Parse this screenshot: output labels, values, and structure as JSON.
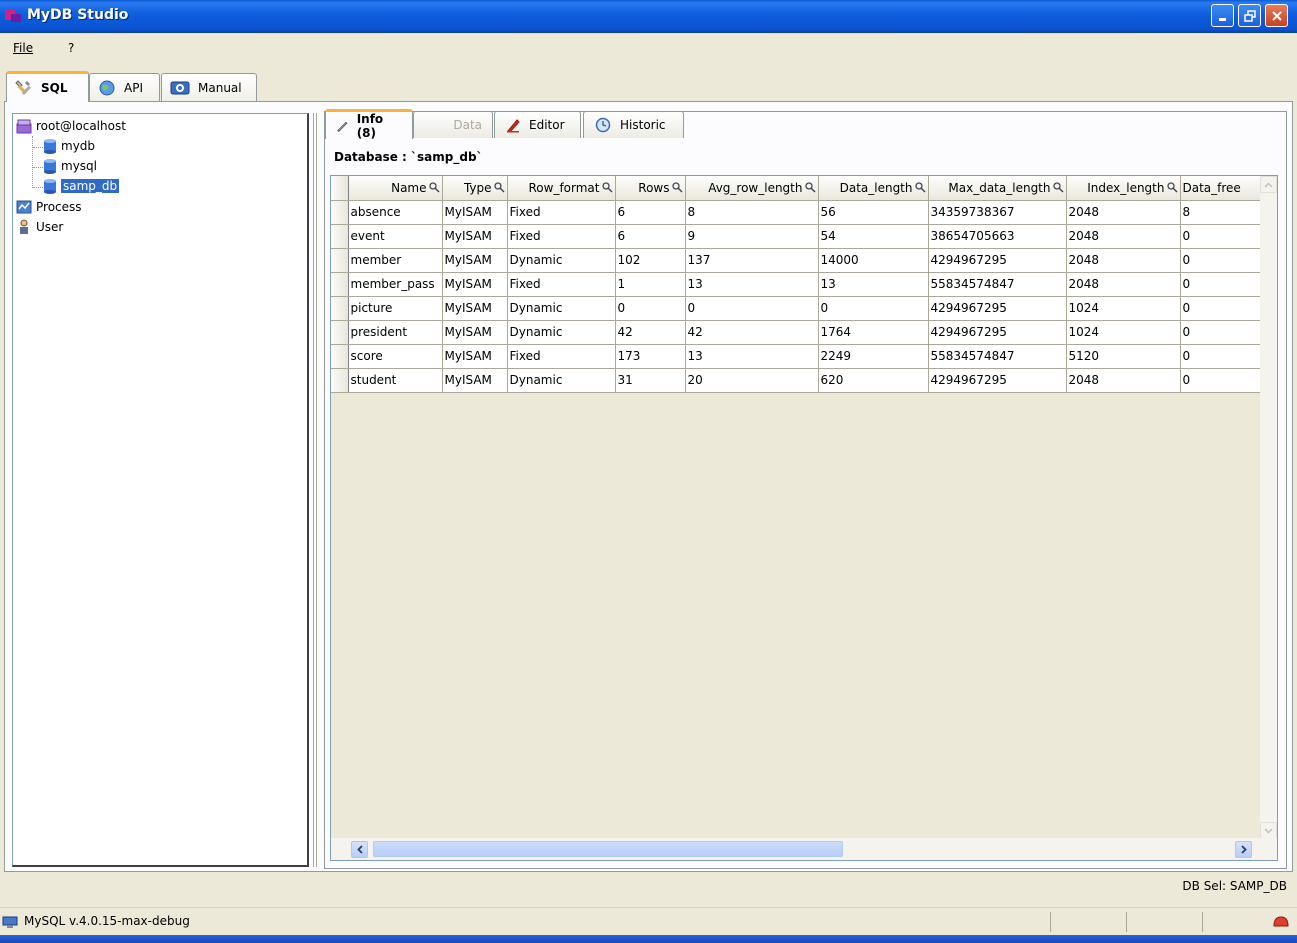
{
  "window": {
    "title": "MyDB Studio"
  },
  "menu": {
    "file": "File",
    "help": "?"
  },
  "top_tabs": [
    {
      "label": "SQL",
      "icon": "tools-icon",
      "active": true
    },
    {
      "label": "API",
      "icon": "globe-icon",
      "active": false
    },
    {
      "label": "Manual",
      "icon": "help-book-icon",
      "active": false
    }
  ],
  "tree": {
    "root": "root@localhost",
    "databases": [
      "mydb",
      "mysql",
      "samp_db"
    ],
    "selected": "samp_db",
    "process": "Process",
    "user": "User"
  },
  "sub_tabs": [
    {
      "label": "Info (8)",
      "icon": "pencil-icon",
      "state": "active"
    },
    {
      "label": "Data",
      "icon": "",
      "state": "disabled"
    },
    {
      "label": "Editor",
      "icon": "red-pen-icon",
      "state": "normal"
    },
    {
      "label": "Historic",
      "icon": "clock-icon",
      "state": "normal"
    }
  ],
  "database_label": "Database : `samp_db`",
  "grid": {
    "columns": [
      "Name",
      "Type",
      "Row_format",
      "Rows",
      "Avg_row_length",
      "Data_length",
      "Max_data_length",
      "Index_length",
      "Data_free"
    ],
    "rows": [
      [
        "absence",
        "MyISAM",
        "Fixed",
        "6",
        "8",
        "56",
        "34359738367",
        "2048",
        "8"
      ],
      [
        "event",
        "MyISAM",
        "Fixed",
        "6",
        "9",
        "54",
        "38654705663",
        "2048",
        "0"
      ],
      [
        "member",
        "MyISAM",
        "Dynamic",
        "102",
        "137",
        "14000",
        "4294967295",
        "2048",
        "0"
      ],
      [
        "member_pass",
        "MyISAM",
        "Fixed",
        "1",
        "13",
        "13",
        "55834574847",
        "2048",
        "0"
      ],
      [
        "picture",
        "MyISAM",
        "Dynamic",
        "0",
        "0",
        "0",
        "4294967295",
        "1024",
        "0"
      ],
      [
        "president",
        "MyISAM",
        "Dynamic",
        "42",
        "42",
        "1764",
        "4294967295",
        "1024",
        "0"
      ],
      [
        "score",
        "MyISAM",
        "Fixed",
        "173",
        "13",
        "2249",
        "55834574847",
        "5120",
        "0"
      ],
      [
        "student",
        "MyISAM",
        "Dynamic",
        "31",
        "20",
        "620",
        "4294967295",
        "2048",
        "0"
      ]
    ]
  },
  "db_sel": "DB Sel: SAMP_DB",
  "status": "MySQL v.4.0.15-max-debug",
  "colors": {
    "titlebar": "#0a53d0",
    "selection": "#316ac5",
    "tab_accent": "#f8b33d"
  }
}
